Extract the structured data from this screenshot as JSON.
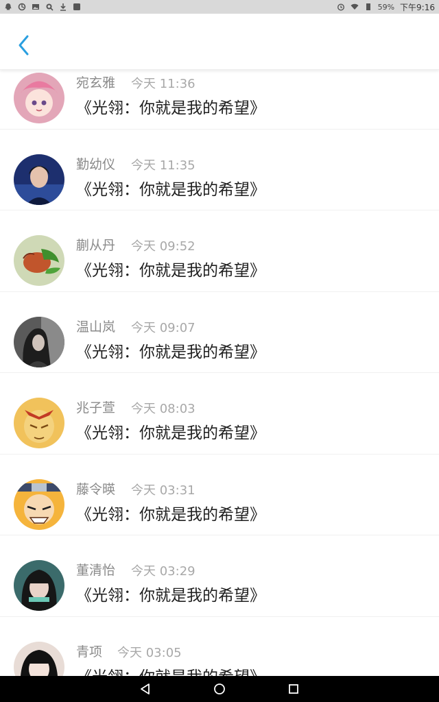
{
  "status_bar": {
    "battery": "59%",
    "time": "下午9:16",
    "left_icons": [
      "qq-icon",
      "sync-icon",
      "image-icon",
      "search-app-icon",
      "download-icon",
      "app-icon"
    ],
    "right_icons": [
      "alarm-icon",
      "wifi-icon",
      "signal-icon"
    ]
  },
  "header": {
    "back_icon": "chevron-left-icon",
    "accent_color": "#2a9fe0"
  },
  "messages": [
    {
      "name": "宛玄雅",
      "time": "今天 11:36",
      "text": "《光翎：你就是我的希望》",
      "avatar": "pink-hair-anime-avatar"
    },
    {
      "name": "勤幼仪",
      "time": "今天 11:35",
      "text": "《光翎：你就是我的希望》",
      "avatar": "young-man-dark-avatar"
    },
    {
      "name": "蒯从丹",
      "time": "今天 09:52",
      "text": "《光翎：你就是我的希望》",
      "avatar": "flower-bud-avatar"
    },
    {
      "name": "温山岚",
      "time": "今天 09:07",
      "text": "《光翎：你就是我的希望》",
      "avatar": "dark-haired-girl-avatar"
    },
    {
      "name": "兆子萱",
      "time": "今天 08:03",
      "text": "《光翎：你就是我的希望》",
      "avatar": "golden-face-anime-avatar"
    },
    {
      "name": "藤令暎",
      "time": "今天 03:31",
      "text": "《光翎：你就是我的希望》",
      "avatar": "ninja-anime-avatar"
    },
    {
      "name": "董清怡",
      "time": "今天 03:29",
      "text": "《光翎：你就是我的希望》",
      "avatar": "girl-bangs-avatar"
    },
    {
      "name": "青项",
      "time": "今天 03:05",
      "text": "《光翎：你就是我的希望》",
      "avatar": "girl-red-text-avatar"
    }
  ],
  "nav_bar": {
    "back_icon": "triangle-back-icon",
    "home_icon": "circle-home-icon",
    "recents_icon": "square-recents-icon"
  }
}
